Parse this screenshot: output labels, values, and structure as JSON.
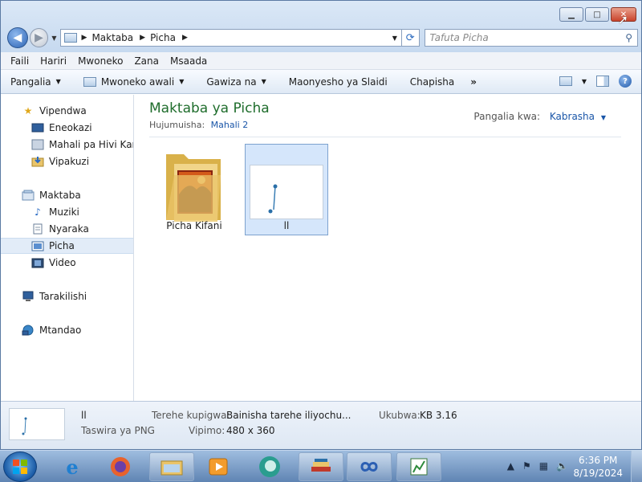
{
  "window": {
    "caption_buttons": {
      "minimize": "▁",
      "maximize": "□",
      "close": "✕"
    }
  },
  "nav": {
    "back_glyph": "◀",
    "forward_glyph": "▶",
    "address": [
      "Maktaba",
      "Picha"
    ],
    "search_placeholder": "Tafuta Picha"
  },
  "menu": [
    "Faili",
    "Hariri",
    "Mwoneko",
    "Zana",
    "Msaada"
  ],
  "commands": {
    "organize": "Pangalia",
    "preview": "Mwoneko awali",
    "share": "Gawiza na",
    "slideshow": "Maonyesho ya Slaidi",
    "burn": "Chapisha",
    "more": "»"
  },
  "sidebar": {
    "favorites": {
      "label": "Vipendwa",
      "icon": "star-icon"
    },
    "fav_items": [
      {
        "label": "Eneokazi",
        "icon": "desktop-icon"
      },
      {
        "label": "Mahali pa Hivi Karibuni",
        "icon": "recent-places-icon"
      },
      {
        "label": "Vipakuzi",
        "icon": "downloads-icon"
      }
    ],
    "libraries": {
      "label": "Maktaba",
      "icon": "library-icon"
    },
    "lib_items": [
      {
        "label": "Muziki",
        "icon": "music-icon"
      },
      {
        "label": "Nyaraka",
        "icon": "documents-icon"
      },
      {
        "label": "Picha",
        "icon": "pictures-icon"
      },
      {
        "label": "Video",
        "icon": "video-icon"
      }
    ],
    "computer": {
      "label": "Tarakilishi",
      "icon": "computer-icon"
    },
    "network": {
      "label": "Mtandao",
      "icon": "network-icon"
    }
  },
  "content": {
    "title": "Maktaba ya Picha",
    "includes_label": "Hujumuisha:",
    "includes_value": "Mahali 2",
    "arrange_label": "Pangalia kwa:",
    "arrange_value": "Kabrasha",
    "items": [
      {
        "label": "Picha Kifani",
        "type": "folder"
      },
      {
        "label": "ll",
        "type": "png"
      }
    ]
  },
  "details": {
    "name": "ll",
    "type": "Taswira ya PNG",
    "date_taken_label": "Terehe kupigwa:",
    "date_taken_value": "Bainisha tarehe iliyochu...",
    "dimensions_label": "Vipimo:",
    "dimensions_value": "480 x 360",
    "size_label": "Ukubwa:",
    "size_value": "KB 3.16"
  },
  "taskbar": {
    "apps": [
      "internet-explorer-icon",
      "firefox-icon",
      "explorer-icon",
      "media-player-icon",
      "app-icon",
      "books-icon",
      "infinity-icon",
      "chart-app-icon"
    ],
    "time": "6:36 PM",
    "date": "8/19/2024"
  }
}
